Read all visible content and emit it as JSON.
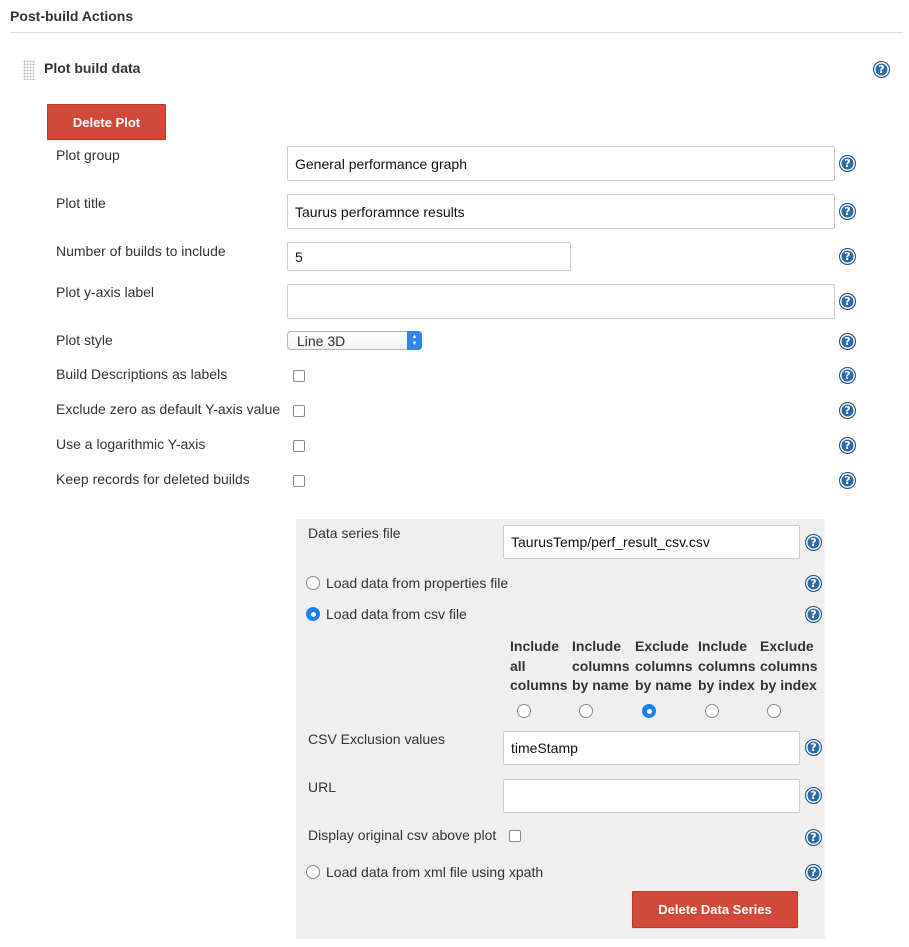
{
  "section": {
    "title": "Post-build Actions"
  },
  "plot_block": {
    "title": "Plot build data",
    "delete_plot_label": "Delete Plot"
  },
  "fields": {
    "plot_group": {
      "label": "Plot group",
      "value": "General performance graph"
    },
    "plot_title": {
      "label": "Plot title",
      "value": "Taurus perforamnce results"
    },
    "num_builds": {
      "label": "Number of builds to include",
      "value": "5"
    },
    "y_axis_label": {
      "label": "Plot y-axis label",
      "value": ""
    },
    "plot_style": {
      "label": "Plot style",
      "selected": "Line 3D"
    }
  },
  "checkboxes": {
    "build_desc_labels": {
      "label": "Build Descriptions as labels",
      "checked": false
    },
    "exclude_zero": {
      "label": "Exclude zero as default Y-axis value",
      "checked": false
    },
    "log_y_axis": {
      "label": "Use a logarithmic Y-axis",
      "checked": false
    },
    "keep_records": {
      "label": "Keep records for deleted builds",
      "checked": false
    }
  },
  "data_series": {
    "file": {
      "label": "Data series file",
      "value": "TaurusTemp/perf_result_csv.csv"
    },
    "load_properties_label": "Load data from properties file",
    "load_csv_label": "Load data from csv file",
    "load_xml_label": "Load data from xml file using xpath",
    "selected_source": "csv",
    "csv_columns": [
      {
        "l1": "Include",
        "l2": "all",
        "l3": "columns"
      },
      {
        "l1": "Include",
        "l2": "columns",
        "l3": "by name"
      },
      {
        "l1": "Exclude",
        "l2": "columns",
        "l3": "by name"
      },
      {
        "l1": "Include",
        "l2": "columns",
        "l3": "by index"
      },
      {
        "l1": "Exclude",
        "l2": "columns",
        "l3": "by index"
      }
    ],
    "selected_column_option": "Exclude columns by name",
    "csv_exclusion": {
      "label": "CSV Exclusion values",
      "value": "timeStamp"
    },
    "url": {
      "label": "URL",
      "value": ""
    },
    "display_original": {
      "label": "Display original csv above plot",
      "checked": false
    },
    "delete_series_label": "Delete Data Series"
  },
  "help_glyph": "?",
  "colors": {
    "accent_red": "#d24939",
    "help_blue": "#2d6ca5",
    "radio_selected": "#1a82ec",
    "panel_bg": "#efefef"
  },
  "icons": {
    "drag": "drag-handle-icon",
    "help": "help-icon",
    "select_arrow": "updown-chevron-icon"
  }
}
